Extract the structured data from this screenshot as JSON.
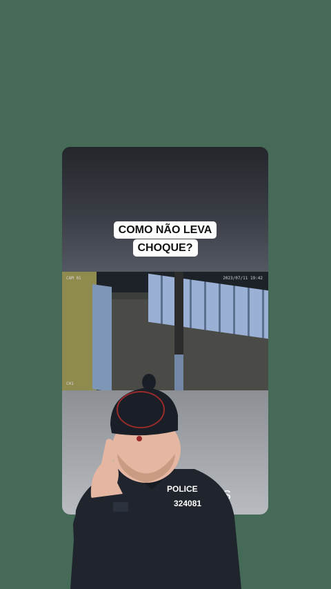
{
  "post": {
    "caption_line1": "COMO NÃO LEVA",
    "caption_line2": "CHOQUE?",
    "overlay_partial_text": "TS"
  },
  "cctv": {
    "timestamp": "2023/07/11 19:42",
    "camera_label_top_left": "CAM 01",
    "camera_label_bottom_left": "CH1"
  },
  "sticker": {
    "badge_title": "POLICE",
    "badge_number": "324081"
  },
  "colors": {
    "background": "#456a58",
    "caption_bg": "#ffffff",
    "uniform": "#1f242d"
  }
}
